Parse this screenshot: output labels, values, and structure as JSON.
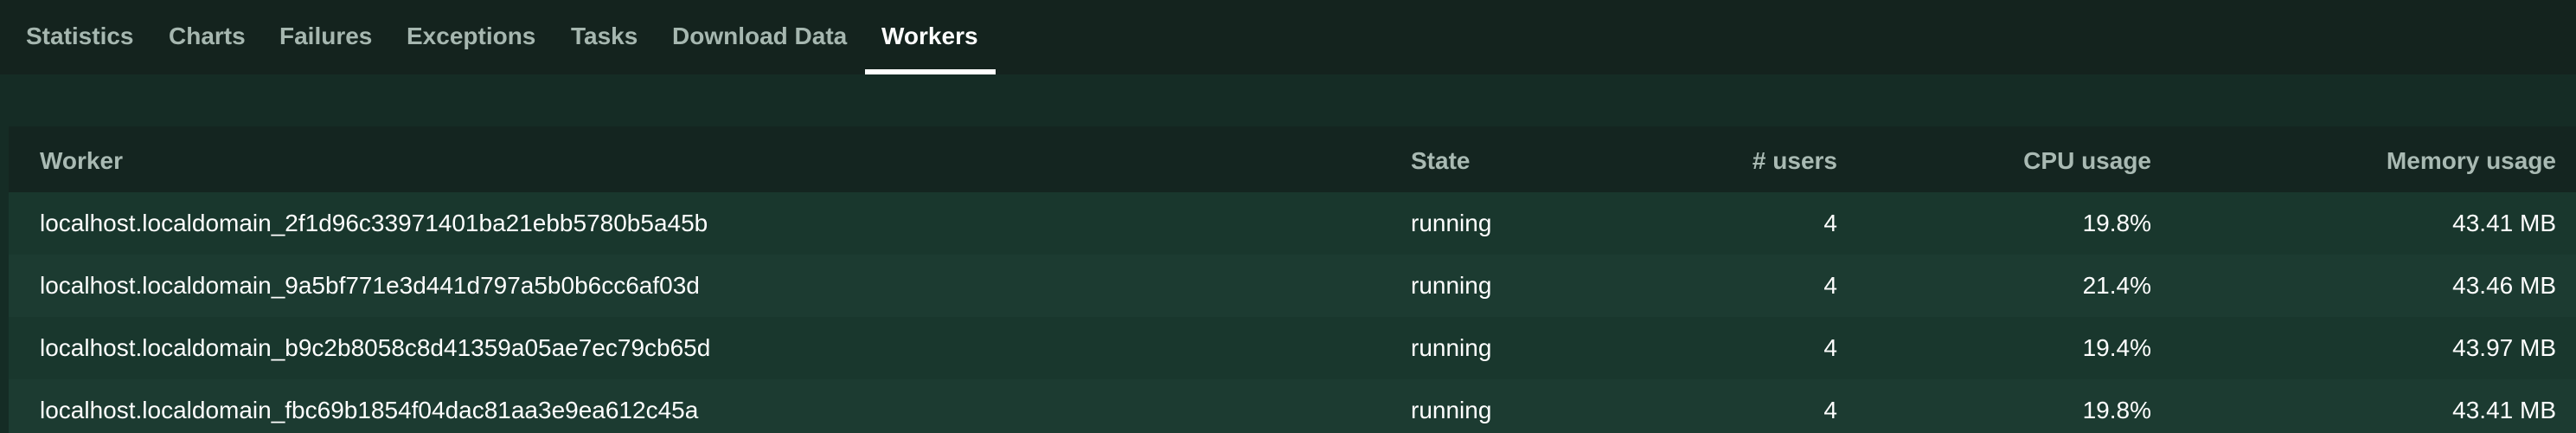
{
  "nav": {
    "tabs": [
      {
        "label": "Statistics"
      },
      {
        "label": "Charts"
      },
      {
        "label": "Failures"
      },
      {
        "label": "Exceptions"
      },
      {
        "label": "Tasks"
      },
      {
        "label": "Download Data"
      },
      {
        "label": "Workers"
      }
    ],
    "active_tab": "Workers"
  },
  "workers_table": {
    "headers": {
      "worker": "Worker",
      "state": "State",
      "users": "# users",
      "cpu": "CPU usage",
      "memory": "Memory usage"
    },
    "rows": [
      {
        "worker": "localhost.localdomain_2f1d96c33971401ba21ebb5780b5a45b",
        "state": "running",
        "users": "4",
        "cpu": "19.8%",
        "memory": "43.41 MB"
      },
      {
        "worker": "localhost.localdomain_9a5bf771e3d441d797a5b0b6cc6af03d",
        "state": "running",
        "users": "4",
        "cpu": "21.4%",
        "memory": "43.46 MB"
      },
      {
        "worker": "localhost.localdomain_b9c2b8058c8d41359a05ae7ec79cb65d",
        "state": "running",
        "users": "4",
        "cpu": "19.4%",
        "memory": "43.97 MB"
      },
      {
        "worker": "localhost.localdomain_fbc69b1854f04dac81aa3e9ea612c45a",
        "state": "running",
        "users": "4",
        "cpu": "19.8%",
        "memory": "43.41 MB"
      }
    ]
  },
  "colors": {
    "page_background": "#152c25",
    "tabbar_background": "#14231e",
    "table_header_background": "#142520",
    "active_tab_underline": "#ffffff"
  }
}
